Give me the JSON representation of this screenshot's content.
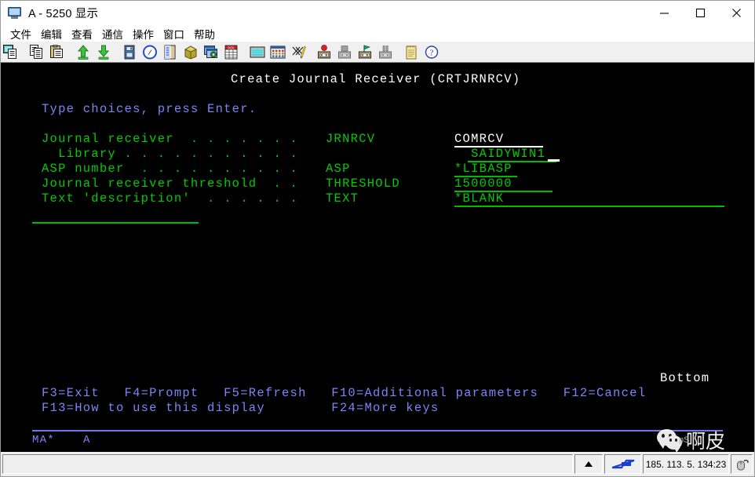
{
  "window": {
    "title": "A - 5250 显示",
    "icon": "monitor-icon",
    "minimize_label": "—",
    "maximize_label": "□",
    "close_label": "✕"
  },
  "menubar": {
    "items": [
      {
        "label": "文件",
        "name": "menu-file"
      },
      {
        "label": "编辑",
        "name": "menu-edit"
      },
      {
        "label": "查看",
        "name": "menu-view"
      },
      {
        "label": "通信",
        "name": "menu-communication"
      },
      {
        "label": "操作",
        "name": "menu-actions"
      },
      {
        "label": "窗口",
        "name": "menu-window"
      },
      {
        "label": "帮助",
        "name": "menu-help"
      }
    ]
  },
  "toolbar": {
    "buttons": [
      {
        "name": "copy-screen-icon"
      },
      {
        "name": "copy-icon"
      },
      {
        "name": "paste-icon"
      },
      {
        "name": "send-file-icon"
      },
      {
        "name": "receive-file-icon"
      },
      {
        "name": "save-icon"
      },
      {
        "name": "navigate-icon"
      },
      {
        "name": "display-icon"
      },
      {
        "name": "package-icon"
      },
      {
        "name": "settings-window-icon"
      },
      {
        "name": "sql-icon"
      },
      {
        "name": "screen-capture-icon"
      },
      {
        "name": "keypad-icon"
      },
      {
        "name": "macro-icon"
      },
      {
        "name": "record-macro-icon"
      },
      {
        "name": "stop-macro-icon"
      },
      {
        "name": "play-macro-icon"
      },
      {
        "name": "pause-macro-icon"
      },
      {
        "name": "notepad-icon"
      },
      {
        "name": "help-icon"
      }
    ]
  },
  "terminal": {
    "title": "Create Journal Receiver (CRTJRNRCV)",
    "instruction": "Type choices, press Enter.",
    "fields": [
      {
        "label": "Journal receiver  . . . . . . .",
        "keyword": "JRNRCV",
        "value": "COMRCV",
        "value_color": "white"
      },
      {
        "label": "  Library . . . . . . . . . . .",
        "keyword": "",
        "value": "  SAIDYWIN1",
        "value_color": "green"
      },
      {
        "label": "ASP number  . . . . . . . . . .",
        "keyword": "ASP",
        "value": "*LIBASP",
        "value_color": "green"
      },
      {
        "label": "Journal receiver threshold  . .",
        "keyword": "THRESHOLD",
        "value": "1500000",
        "value_color": "green"
      },
      {
        "label": "Text 'description'  . . . . . .",
        "keyword": "TEXT",
        "value": "*BLANK",
        "value_color": "green"
      }
    ],
    "page_indicator": "Bottom",
    "function_keys_line1": "F3=Exit   F4=Prompt   F5=Refresh   F10=Additional parameters   F12=Cancel",
    "function_keys_line2": "F13=How to use this display        F24=More keys",
    "status_indicator_left": "MA*",
    "status_indicator_right": "A"
  },
  "watermark": {
    "brand": "wechat-logo",
    "text": "啊皮",
    "subtext": "pS"
  },
  "statusbar": {
    "main_text": "",
    "arrow_icon": "up-arrow-icon",
    "network_icon": "network-connected-icon",
    "ip_address": "185. 113. 5. 134:23",
    "lock_icon": "mouse-lock-icon"
  },
  "colors": {
    "terminal_bg": "#000000",
    "green": "#00cc00",
    "white": "#ffffff",
    "blue": "#7e84f7",
    "toolbar_bg": "#f0f0f0"
  }
}
